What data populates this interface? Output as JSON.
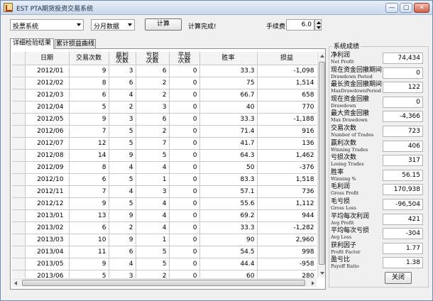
{
  "window": {
    "title": "EST PTA期货投资交易系统",
    "min_glyph": "—",
    "max_glyph": "▢",
    "close_glyph": "✕"
  },
  "toolbar": {
    "system_select": "投票系统",
    "period_select": "分月数据",
    "calc_button": "计算",
    "status": "计算完成!",
    "fee_label": "手续费",
    "fee_value": "6.0"
  },
  "tabs": [
    {
      "label": "详细检验结果",
      "active": true
    },
    {
      "label": "累计损益曲线",
      "active": false
    }
  ],
  "table": {
    "headers": [
      "日期",
      "交易次数",
      "赢利次数",
      "亏损次数",
      "平局次数",
      "胜率",
      "损益"
    ],
    "rows": [
      [
        "2012/01",
        "9",
        "3",
        "6",
        "0",
        "33.3",
        "-1,098"
      ],
      [
        "2012/02",
        "8",
        "6",
        "2",
        "0",
        "75",
        "1,514"
      ],
      [
        "2012/03",
        "6",
        "4",
        "2",
        "0",
        "66.7",
        "658"
      ],
      [
        "2012/04",
        "5",
        "2",
        "3",
        "0",
        "40",
        "770"
      ],
      [
        "2012/05",
        "9",
        "3",
        "6",
        "0",
        "33.3",
        "-1,188"
      ],
      [
        "2012/06",
        "7",
        "5",
        "2",
        "0",
        "71.4",
        "916"
      ],
      [
        "2012/07",
        "12",
        "5",
        "7",
        "0",
        "41.7",
        "136"
      ],
      [
        "2012/08",
        "14",
        "9",
        "5",
        "0",
        "64.3",
        "1,462"
      ],
      [
        "2012/09",
        "8",
        "4",
        "4",
        "0",
        "50",
        "-376"
      ],
      [
        "2012/10",
        "6",
        "5",
        "1",
        "0",
        "83.3",
        "1,518"
      ],
      [
        "2012/11",
        "7",
        "4",
        "3",
        "0",
        "57.1",
        "736"
      ],
      [
        "2012/12",
        "9",
        "5",
        "4",
        "0",
        "55.6",
        "1,112"
      ],
      [
        "2013/01",
        "13",
        "9",
        "4",
        "0",
        "69.2",
        "944"
      ],
      [
        "2013/02",
        "6",
        "2",
        "4",
        "0",
        "33.3",
        "-1,282"
      ],
      [
        "2013/03",
        "10",
        "9",
        "1",
        "0",
        "90",
        "2,960"
      ],
      [
        "2013/04",
        "11",
        "6",
        "5",
        "0",
        "54.5",
        "998"
      ],
      [
        "2013/05",
        "9",
        "4",
        "5",
        "0",
        "44.4",
        "-958"
      ],
      [
        "2013/06",
        "5",
        "3",
        "2",
        "0",
        "60",
        "280"
      ],
      [
        "2013/07",
        "7",
        "5",
        "2",
        "0",
        "71.4",
        "1,136"
      ]
    ]
  },
  "stats": {
    "title": "系统成绩",
    "items": [
      {
        "zh": "净利润",
        "en": "Net Profit",
        "value": "74,434"
      },
      {
        "zh": "现在资金回撤期间",
        "en": "Drawdown Period",
        "value": "0"
      },
      {
        "zh": "最长资金回撤期间",
        "en": "MaxDrawdownPeriod",
        "value": "122"
      },
      {
        "zh": "现在资金回撤",
        "en": "Drawdown",
        "value": "0"
      },
      {
        "zh": "最大资金回撤",
        "en": "Max Drawdown",
        "value": "-4,366"
      },
      {
        "zh": "交易次数",
        "en": "Number of Trades",
        "value": "723"
      },
      {
        "zh": "赢利次数",
        "en": "Winning Trades",
        "value": "406"
      },
      {
        "zh": "亏损次数",
        "en": "Losing Trades",
        "value": "317"
      },
      {
        "zh": "胜率",
        "en": "Winning %",
        "value": "56.15"
      },
      {
        "zh": "毛利润",
        "en": "Gross Profit",
        "value": "170,938"
      },
      {
        "zh": "毛亏损",
        "en": "Gross Loss",
        "value": "-96,504"
      },
      {
        "zh": "平均每次利润",
        "en": "Avg Profit",
        "value": "421"
      },
      {
        "zh": "平均每次亏损",
        "en": "Avg Loss",
        "value": "-304"
      },
      {
        "zh": "获利因子",
        "en": "Profit Factor",
        "value": "1.77"
      },
      {
        "zh": "盈亏比",
        "en": "Payoff Ratio",
        "value": "1.38"
      }
    ],
    "close_button": "关闭"
  }
}
